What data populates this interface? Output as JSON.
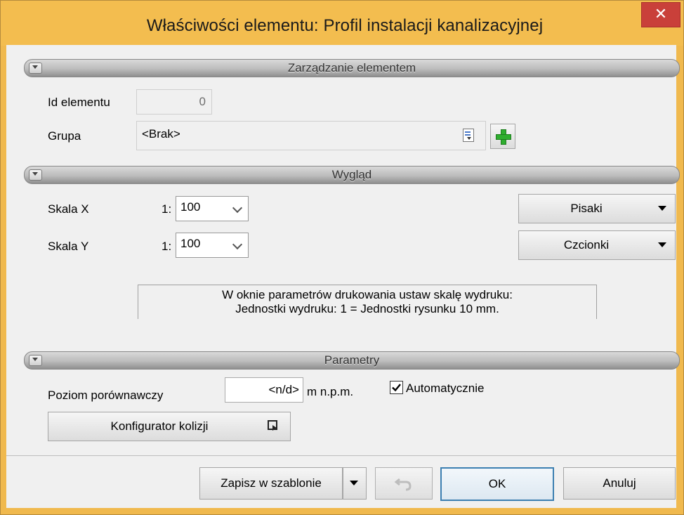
{
  "window": {
    "title": "Właściwości elementu: Profil instalacji kanalizacyjnej",
    "close_glyph": "✕"
  },
  "sections": {
    "management": {
      "title": "Zarządzanie elementem",
      "id_label": "Id elementu",
      "id_value": "0",
      "group_label": "Grupa",
      "group_value": "<Brak>"
    },
    "appearance": {
      "title": "Wygląd",
      "scale_x_label": "Skala X",
      "scale_y_label": "Skala Y",
      "scale_prefix": "1:",
      "scale_x_value": "100",
      "scale_y_value": "100",
      "pens_button": "Pisaki",
      "fonts_button": "Czcionki",
      "info_line1": "W oknie parametrów drukowania ustaw skalę wydruku:",
      "info_line2": "Jednostki wydruku: 1 = Jednostki rysunku 10 mm."
    },
    "parameters": {
      "title": "Parametry",
      "reference_level_label": "Poziom porównawczy",
      "reference_level_value": "<n/d>",
      "unit": "m n.p.m.",
      "auto_label": "Automatycznie",
      "auto_checked": true,
      "collision_button": "Konfigurator kolizji"
    }
  },
  "footer": {
    "save_template": "Zapisz w szablonie",
    "ok": "OK",
    "cancel": "Anuluj"
  },
  "colors": {
    "title_bar": "#f3bd4f",
    "close": "#c9403a",
    "plus": "#2fae2f"
  }
}
